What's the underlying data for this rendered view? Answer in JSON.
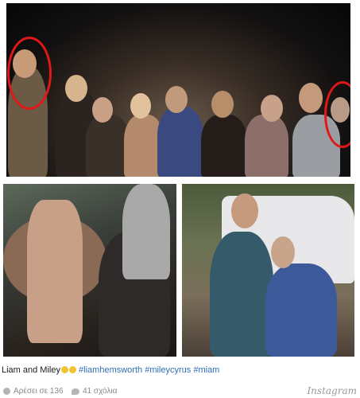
{
  "post": {
    "caption_text": "Liam and Miley",
    "hashtags": [
      "#liamhemsworth",
      "#mileycyrus",
      "#miam"
    ],
    "emoji_count": 2
  },
  "stats": {
    "likes_label": "Αρέσει σε 136",
    "comments_label": "41 σχόλια"
  },
  "brand": {
    "name": "Instagram"
  },
  "colors": {
    "highlight_circle": "#e01818",
    "hashtag": "#2e6fb5",
    "stats_text": "#8a8a8a"
  },
  "icons": {
    "likes": "heart-icon",
    "comments": "comment-icon"
  }
}
